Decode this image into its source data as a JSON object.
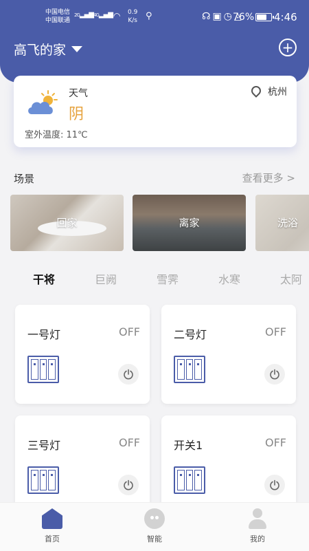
{
  "status_bar": {
    "carrier_1": "中国电信",
    "carrier_2": "中国联通",
    "net_1": "2G",
    "net_2": "4G",
    "speed_value": "0.9",
    "speed_unit": "K/s",
    "battery_pct": "76%",
    "battery_level": 0.76,
    "time": "4:46",
    "icons": [
      "headphones-icon",
      "nfc-icon",
      "alarm-icon",
      "mute-icon"
    ]
  },
  "header": {
    "home_name": "高飞的家",
    "add_label": "+"
  },
  "weather": {
    "label": "天气",
    "condition": "阴",
    "city": "杭州",
    "outdoor_temp": "室外温度: 11℃",
    "icon": "cloud-sun-icon"
  },
  "scenes": {
    "title": "场景",
    "see_more": "查看更多 >",
    "items": [
      {
        "label": "回家"
      },
      {
        "label": "离家"
      },
      {
        "label": "洗浴"
      }
    ]
  },
  "tabs": [
    {
      "label": "干将",
      "active": true
    },
    {
      "label": "巨阙",
      "active": false
    },
    {
      "label": "雪霁",
      "active": false
    },
    {
      "label": "水寒",
      "active": false
    },
    {
      "label": "太阿",
      "active": false
    }
  ],
  "devices": [
    {
      "name": "一号灯",
      "state": "OFF"
    },
    {
      "name": "二号灯",
      "state": "OFF"
    },
    {
      "name": "三号灯",
      "state": "OFF"
    },
    {
      "name": "开关1",
      "state": "OFF"
    }
  ],
  "nav": [
    {
      "label": "首页",
      "icon": "home-icon",
      "active": true
    },
    {
      "label": "智能",
      "icon": "robot-icon",
      "active": false
    },
    {
      "label": "我的",
      "icon": "user-icon",
      "active": false
    }
  ],
  "colors": {
    "primary": "#4a5ca8",
    "weather_accent": "#e6a23c",
    "background": "#f3f3f5"
  }
}
